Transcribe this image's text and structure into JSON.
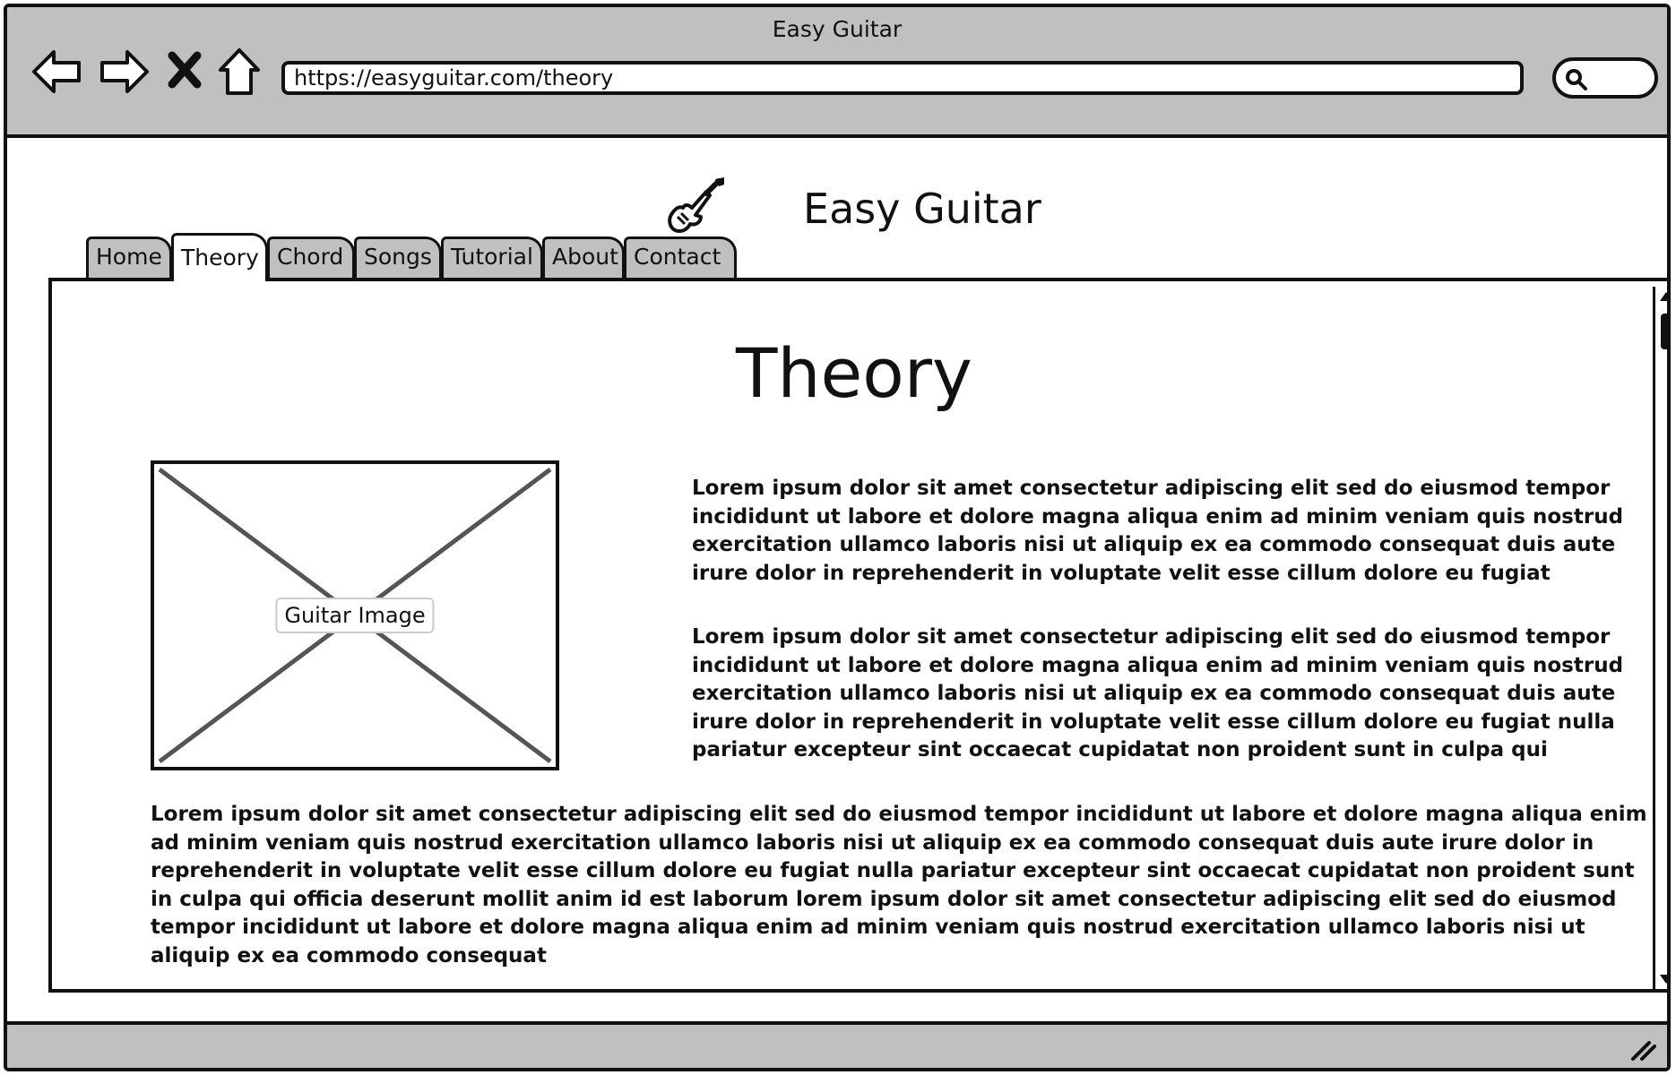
{
  "window": {
    "title": "Easy Guitar"
  },
  "browser": {
    "url": "https://easyguitar.com/theory",
    "nav_icons": [
      "back-arrow-icon",
      "forward-arrow-icon",
      "stop-icon",
      "home-icon"
    ]
  },
  "site": {
    "title": "Easy Guitar",
    "logo_icon": "electric-guitar-icon"
  },
  "tabs": [
    {
      "label": "Home",
      "active": false
    },
    {
      "label": "Theory",
      "active": true
    },
    {
      "label": "Chord",
      "active": false
    },
    {
      "label": "Songs",
      "active": false
    },
    {
      "label": "Tutorial",
      "active": false
    },
    {
      "label": "About",
      "active": false
    },
    {
      "label": "Contact",
      "active": false
    }
  ],
  "page": {
    "heading": "Theory",
    "image_label": "Guitar Image",
    "paragraphs": [
      "Lorem ipsum dolor sit amet consectetur adipiscing elit sed do eiusmod tempor incididunt ut labore et dolore magna aliqua enim ad minim veniam quis nostrud exercitation ullamco laboris nisi ut aliquip ex ea commodo consequat duis aute irure dolor in reprehenderit in voluptate velit esse cillum dolore eu fugiat",
      "Lorem ipsum dolor sit amet consectetur adipiscing elit sed do eiusmod tempor incididunt ut labore et dolore magna aliqua enim ad minim veniam quis nostrud exercitation ullamco laboris nisi ut aliquip ex ea commodo consequat duis aute irure dolor in reprehenderit in voluptate velit esse cillum dolore eu fugiat nulla pariatur excepteur sint occaecat cupidatat non proident sunt in culpa qui",
      "Lorem ipsum dolor sit amet consectetur adipiscing elit sed do eiusmod tempor incididunt ut labore et dolore magna aliqua enim ad minim veniam quis nostrud exercitation ullamco laboris nisi ut aliquip ex ea commodo consequat duis aute irure dolor in reprehenderit in voluptate velit esse cillum dolore eu fugiat nulla pariatur excepteur sint occaecat cupidatat non proident sunt in culpa qui officia deserunt mollit anim id est laborum lorem ipsum dolor sit amet consectetur adipiscing elit sed do eiusmod tempor incididunt ut labore et dolore magna aliqua enim ad minim veniam quis nostrud exercitation ullamco laboris nisi ut aliquip ex ea commodo consequat"
    ]
  }
}
